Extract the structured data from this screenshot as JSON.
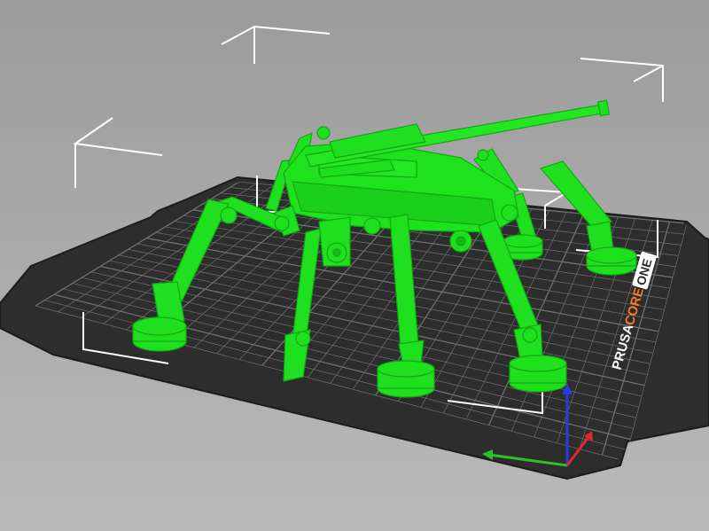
{
  "viewer": {
    "bed_logo": {
      "brand": "PRUSA",
      "model": "CORE",
      "variant": "ONE"
    },
    "colors": {
      "background": "#a6a6a6",
      "bed_surface": "#2d2d2d",
      "grid_line": "#6f6f6f",
      "model": "#1ee01e",
      "model_shadow": "#13a813",
      "selection_box": "#ffffff",
      "axis_x": "#e02a2a",
      "axis_y": "#2ac22a",
      "axis_z": "#2a3ae0",
      "logo_accent": "#f37b22"
    },
    "icons": [
      "bounding-box-corner-icon",
      "axis-gizmo-icon"
    ],
    "model_name": ""
  }
}
